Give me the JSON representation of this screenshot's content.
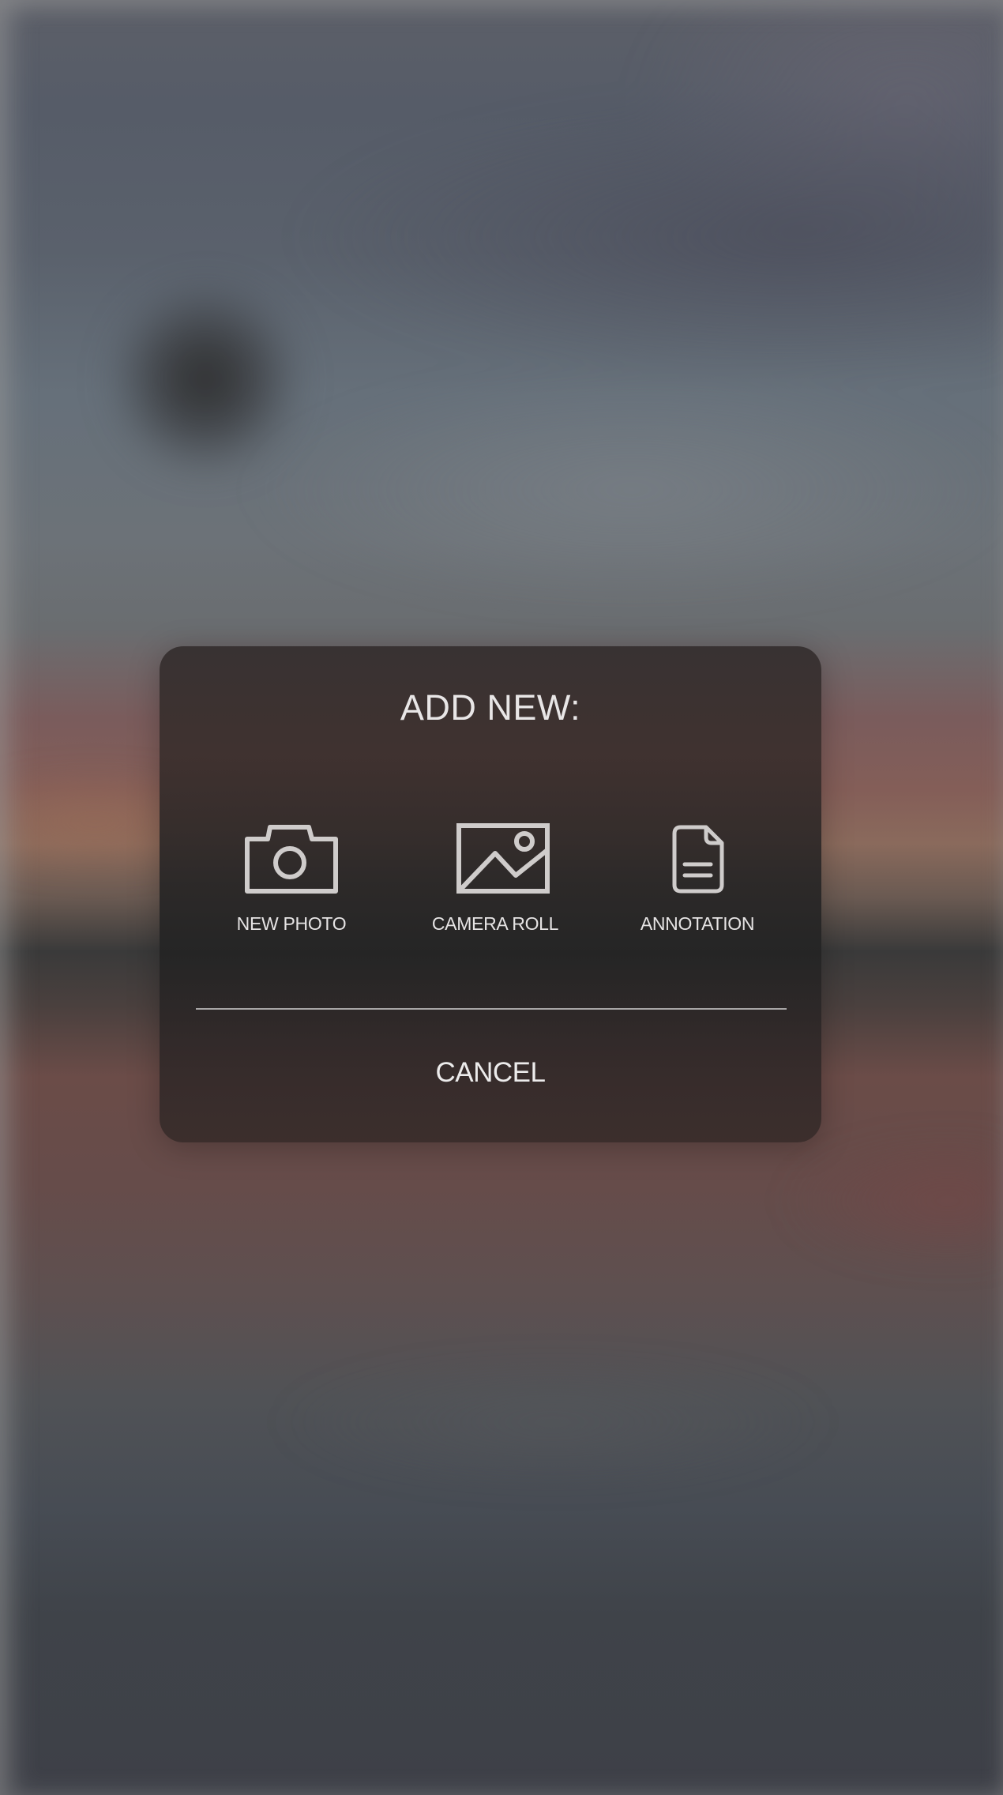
{
  "dialog": {
    "title": "ADD NEW:",
    "options": [
      {
        "label": "NEW PHOTO",
        "icon": "camera-icon"
      },
      {
        "label": "CAMERA ROLL",
        "icon": "image-icon"
      },
      {
        "label": "ANNOTATION",
        "icon": "document-icon"
      }
    ],
    "cancel_label": "CANCEL"
  },
  "colors": {
    "dialog_background": "#2e2a2a",
    "text": "#e8e6e6",
    "icon_stroke": "#cfcccb",
    "divider": "#d2d0d0"
  }
}
